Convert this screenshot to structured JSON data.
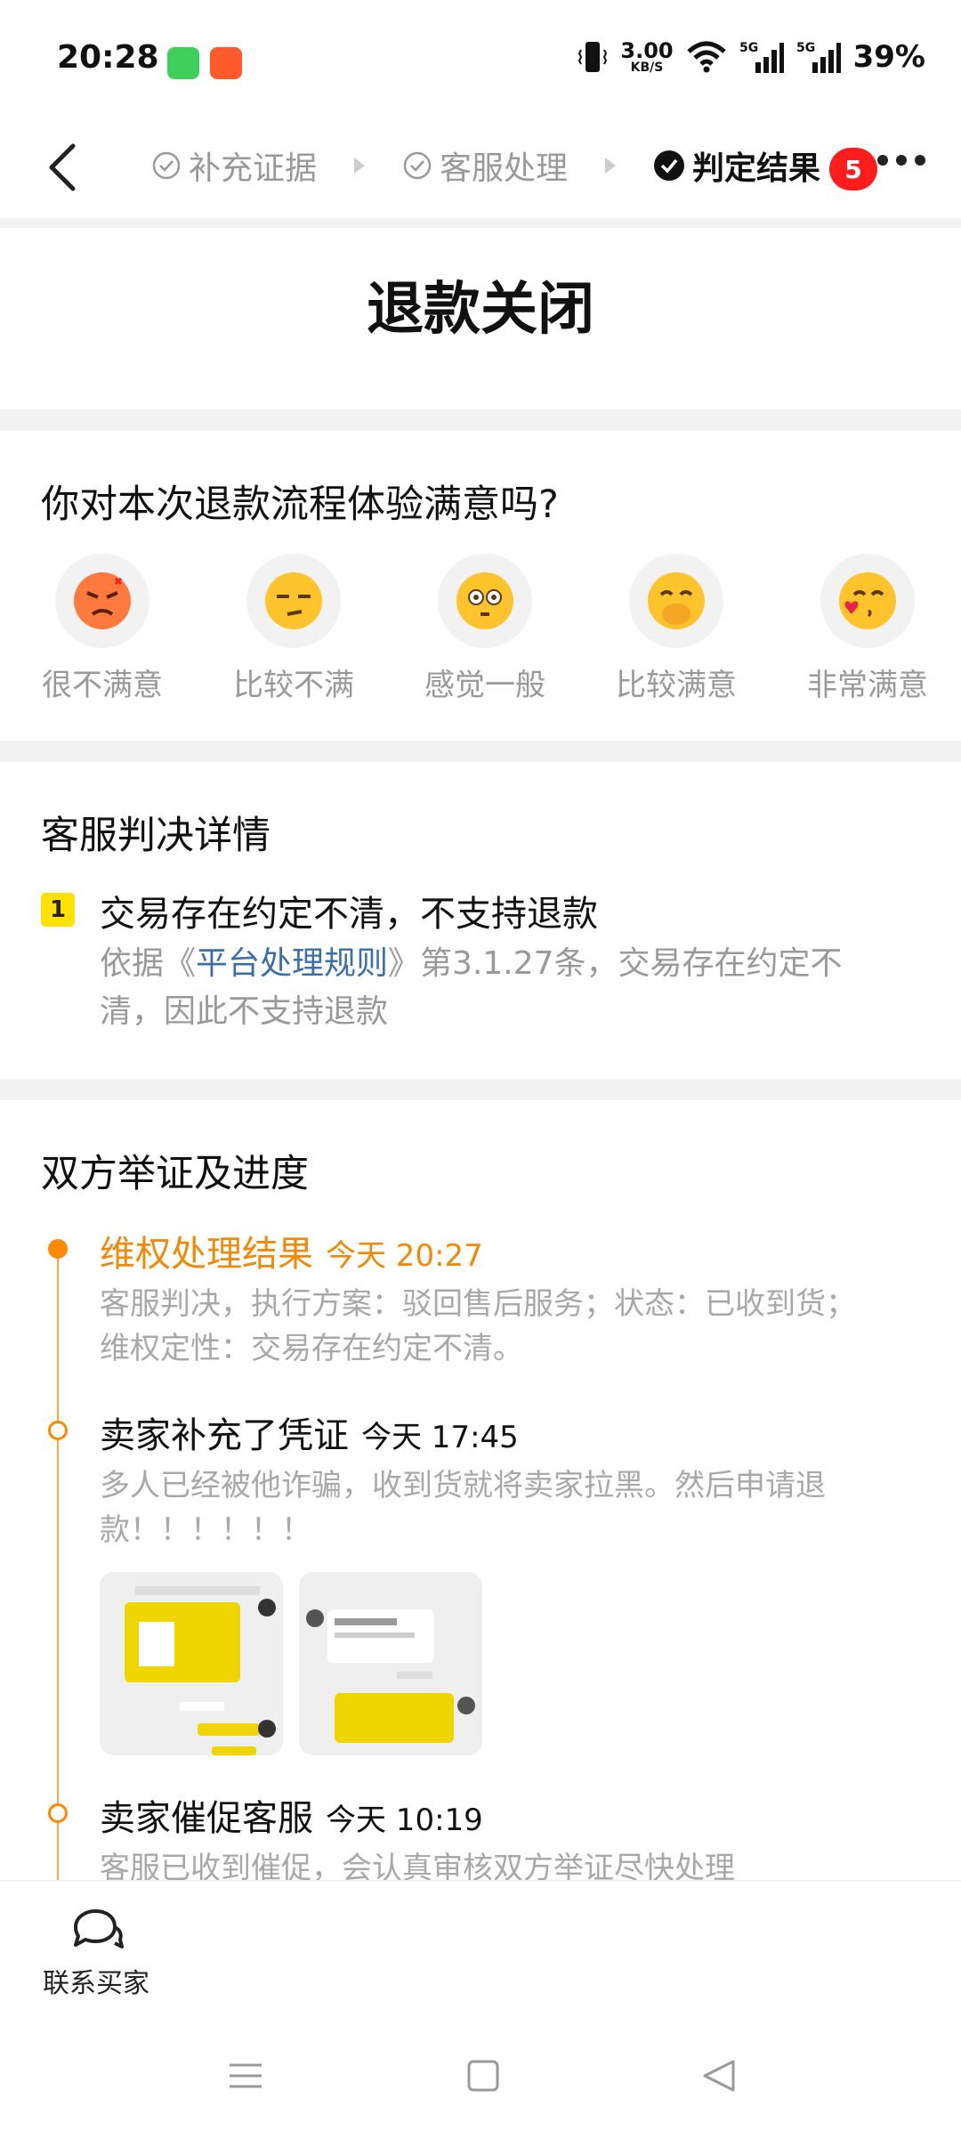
{
  "status_bar": {
    "time": "20:28",
    "net_speed_value": "3.00",
    "net_speed_unit": "KB/S",
    "battery": "39%",
    "icons": [
      "message-app-icon",
      "camera-app-icon",
      "vibrate-icon",
      "wifi-icon",
      "signal-5g-icon",
      "signal-5g-icon"
    ]
  },
  "nav": {
    "steps": [
      {
        "label": "补充证据",
        "active": false
      },
      {
        "label": "客服处理",
        "active": false
      },
      {
        "label": "判定结果",
        "active": true
      }
    ],
    "badge": "5"
  },
  "result": {
    "title": "退款关闭"
  },
  "satisfaction": {
    "question": "你对本次退款流程体验满意吗?",
    "options": [
      {
        "label": "很不满意",
        "icon": "angry-face-icon"
      },
      {
        "label": "比较不满",
        "icon": "unamused-face-icon"
      },
      {
        "label": "感觉一般",
        "icon": "flushed-face-icon"
      },
      {
        "label": "比较满意",
        "icon": "hand-over-mouth-face-icon"
      },
      {
        "label": "非常满意",
        "icon": "kissing-heart-face-icon"
      }
    ]
  },
  "verdict": {
    "section_title": "客服判决详情",
    "number": "1",
    "headline": "交易存在约定不清，不支持退款",
    "body_prefix": "依据《",
    "body_link": "平台处理规则",
    "body_suffix": "》第3.1.27条，交易存在约定不清，因此不支持退款"
  },
  "timeline": {
    "section_title": "双方举证及进度",
    "items": [
      {
        "title": "维权处理结果",
        "time": "今天 20:27",
        "desc": "客服判决，执行方案：驳回售后服务；状态：已收到货；维权定性：交易存在约定不清。"
      },
      {
        "title": "卖家补充了凭证",
        "time": "今天 17:45",
        "desc": "多人已经被他诈骗，收到货就将卖家拉黑。然后申请退款！！！！！！"
      },
      {
        "title": "卖家催促客服",
        "time": "今天 10:19",
        "desc": "客服已收到催促，会认真审核双方举证尽快处理"
      }
    ]
  },
  "bottom": {
    "contact_label": "联系买家"
  },
  "colors": {
    "accent_orange": "#ff8a00",
    "badge_red": "#ff1d1d",
    "highlight_yellow": "#ffe100",
    "link_blue": "#3c6fa8"
  }
}
